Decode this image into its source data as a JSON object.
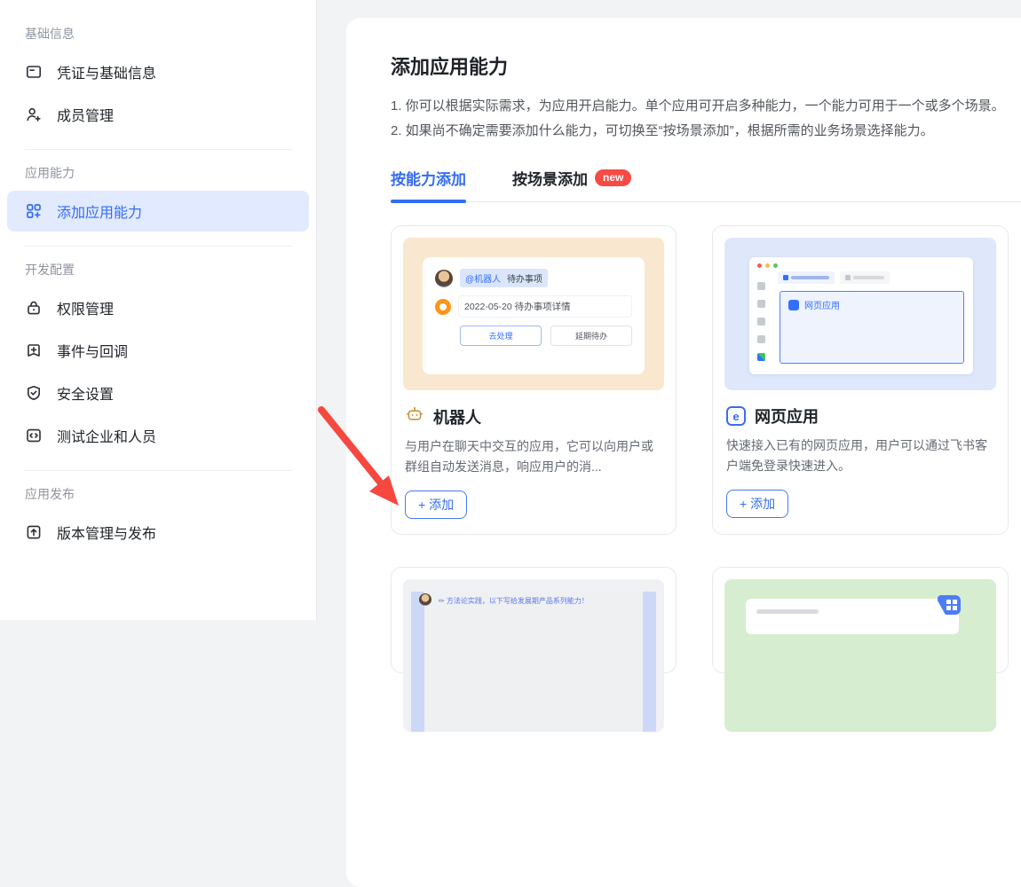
{
  "colors": {
    "accent_blue": "#3370ff",
    "selected_bg": "#e1eaff",
    "badge_red": "#f54a45",
    "arrow_red": "#f5483f",
    "robot_amber": "#c8923d",
    "illus_peach": "#f9e7cf",
    "illus_lavender": "#dfe8fb",
    "illus_green": "#d6eecf"
  },
  "sidebar": {
    "sections": [
      {
        "header": "基础信息",
        "items": [
          {
            "label": "凭证与基础信息"
          },
          {
            "label": "成员管理"
          }
        ]
      },
      {
        "header": "应用能力",
        "items": [
          {
            "label": "添加应用能力",
            "selected": true
          }
        ]
      },
      {
        "header": "开发配置",
        "items": [
          {
            "label": "权限管理"
          },
          {
            "label": "事件与回调"
          },
          {
            "label": "安全设置"
          },
          {
            "label": "测试企业和人员"
          }
        ]
      },
      {
        "header": "应用发布",
        "items": [
          {
            "label": "版本管理与发布"
          }
        ]
      }
    ]
  },
  "main": {
    "title": "添加应用能力",
    "steps": [
      "1. 你可以根据实际需求，为应用开启能力。单个应用可开启多种能力，一个能力可用于一个或多个场景。",
      "2. 如果尚不确定需要添加什么能力，可切换至“按场景添加”，根据所需的业务场景选择能力。"
    ],
    "tabs": [
      {
        "label": "按能力添加",
        "active": true
      },
      {
        "label": "按场景添加",
        "badge": "new"
      }
    ],
    "cards": [
      {
        "title": "机器人",
        "description": "与用户在聊天中交互的应用，它可以向用户或群组自动发送消息，响应用户的消...",
        "add_label": "+ 添加",
        "illustration": {
          "chip_mention": "@机器人",
          "chip_topic": "待办事项",
          "todo_line": "2022-05-20 待办事项详情",
          "btn_primary": "去处理",
          "btn_secondary": "延期待办"
        }
      },
      {
        "title": "网页应用",
        "description": "快速接入已有的网页应用，用户可以通过飞书客户端免登录快速进入。",
        "add_label": "+ 添加",
        "illustration": {
          "app_label": "网页应用"
        }
      }
    ],
    "partials": [
      {
        "caption": "✏ 方法论实践，以下写给发展期产品系列能力！"
      }
    ]
  }
}
